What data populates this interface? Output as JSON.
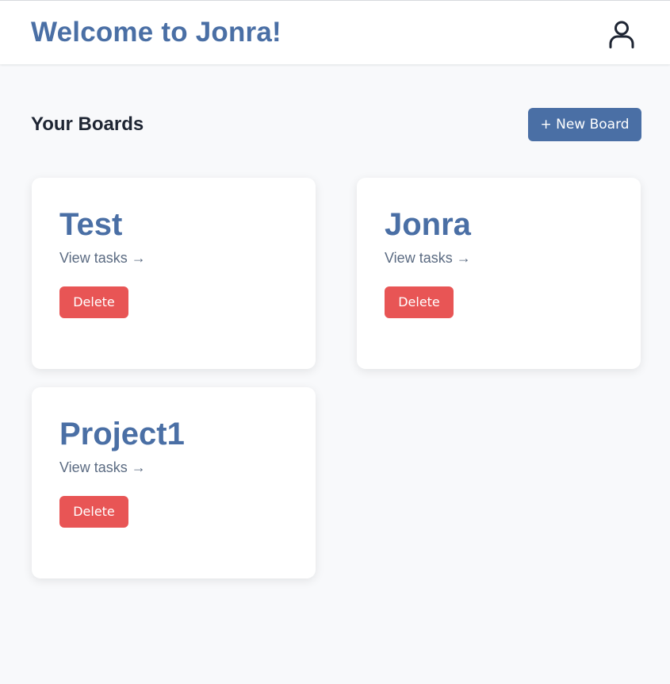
{
  "header": {
    "title": "Welcome to Jonra!",
    "user_icon": "user-icon"
  },
  "section": {
    "title": "Your Boards",
    "new_board_label": "+ New Board"
  },
  "boards": [
    {
      "name": "Test",
      "link_label": "View tasks →",
      "delete_label": "Delete"
    },
    {
      "name": "Jonra",
      "link_label": "View tasks →",
      "delete_label": "Delete"
    },
    {
      "name": "Project1",
      "link_label": "View tasks →",
      "delete_label": "Delete"
    }
  ],
  "colors": {
    "brand": "#4a6fa5",
    "danger": "#e85555",
    "background": "#f8f9fb"
  }
}
